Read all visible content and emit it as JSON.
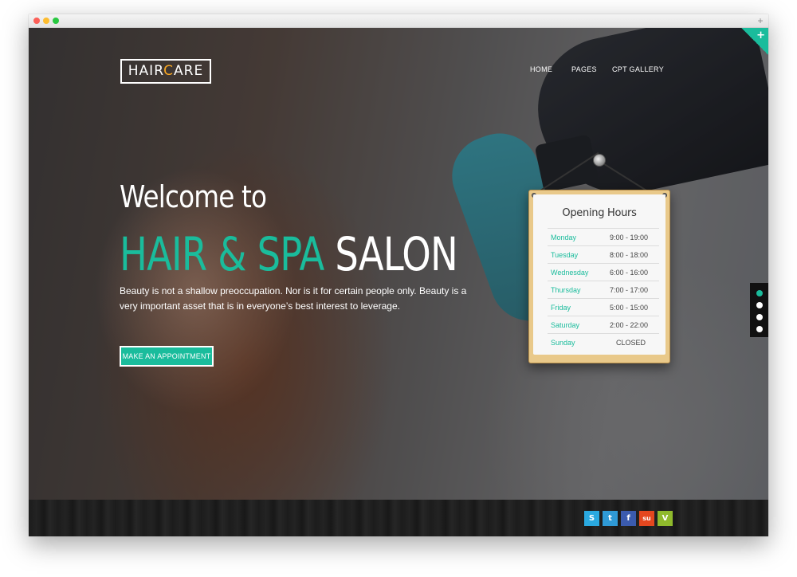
{
  "nav": {
    "items": [
      "HOME",
      "PAGES",
      "CPT GALLERY"
    ]
  },
  "logo": {
    "part1": "HAIR",
    "c": "C",
    "part2": "ARE"
  },
  "hero": {
    "welcome": "Welcome to",
    "headline_accent": "HAIR & SPA",
    "headline_plain": "SALON",
    "tagline": "Beauty is not a shallow preoccupation. Nor is it for certain people only. Beauty is a very important asset that is in everyone’s best interest to leverage.",
    "cta": "MAKE AN APPOINTMENT"
  },
  "hours": {
    "title": "Opening Hours",
    "rows": [
      {
        "day": "Monday",
        "time": "9:00 - 19:00"
      },
      {
        "day": "Tuesday",
        "time": "8:00 - 18:00"
      },
      {
        "day": "Wednesday",
        "time": "6:00 - 16:00"
      },
      {
        "day": "Thursday",
        "time": "7:00 - 17:00"
      },
      {
        "day": "Friday",
        "time": "5:00 - 15:00"
      },
      {
        "day": "Saturday",
        "time": "2:00 - 22:00"
      },
      {
        "day": "Sunday",
        "time": "CLOSED"
      }
    ]
  },
  "slider": {
    "count": 4,
    "active": 0
  },
  "social": [
    {
      "name": "skype-icon",
      "glyph": "S",
      "color": "#2aa9e0"
    },
    {
      "name": "twitter-icon",
      "glyph": "t",
      "color": "#2f9ad6"
    },
    {
      "name": "facebook-icon",
      "glyph": "f",
      "color": "#3b5bae"
    },
    {
      "name": "stumbleupon-icon",
      "glyph": "su",
      "color": "#e4471f"
    },
    {
      "name": "vimeo-icon",
      "glyph": "V",
      "color": "#8fba2c"
    }
  ],
  "colors": {
    "accent": "#1abc9c",
    "logo_c": "#f5a623"
  },
  "window": {
    "new_tab": "+",
    "corner": "+"
  }
}
